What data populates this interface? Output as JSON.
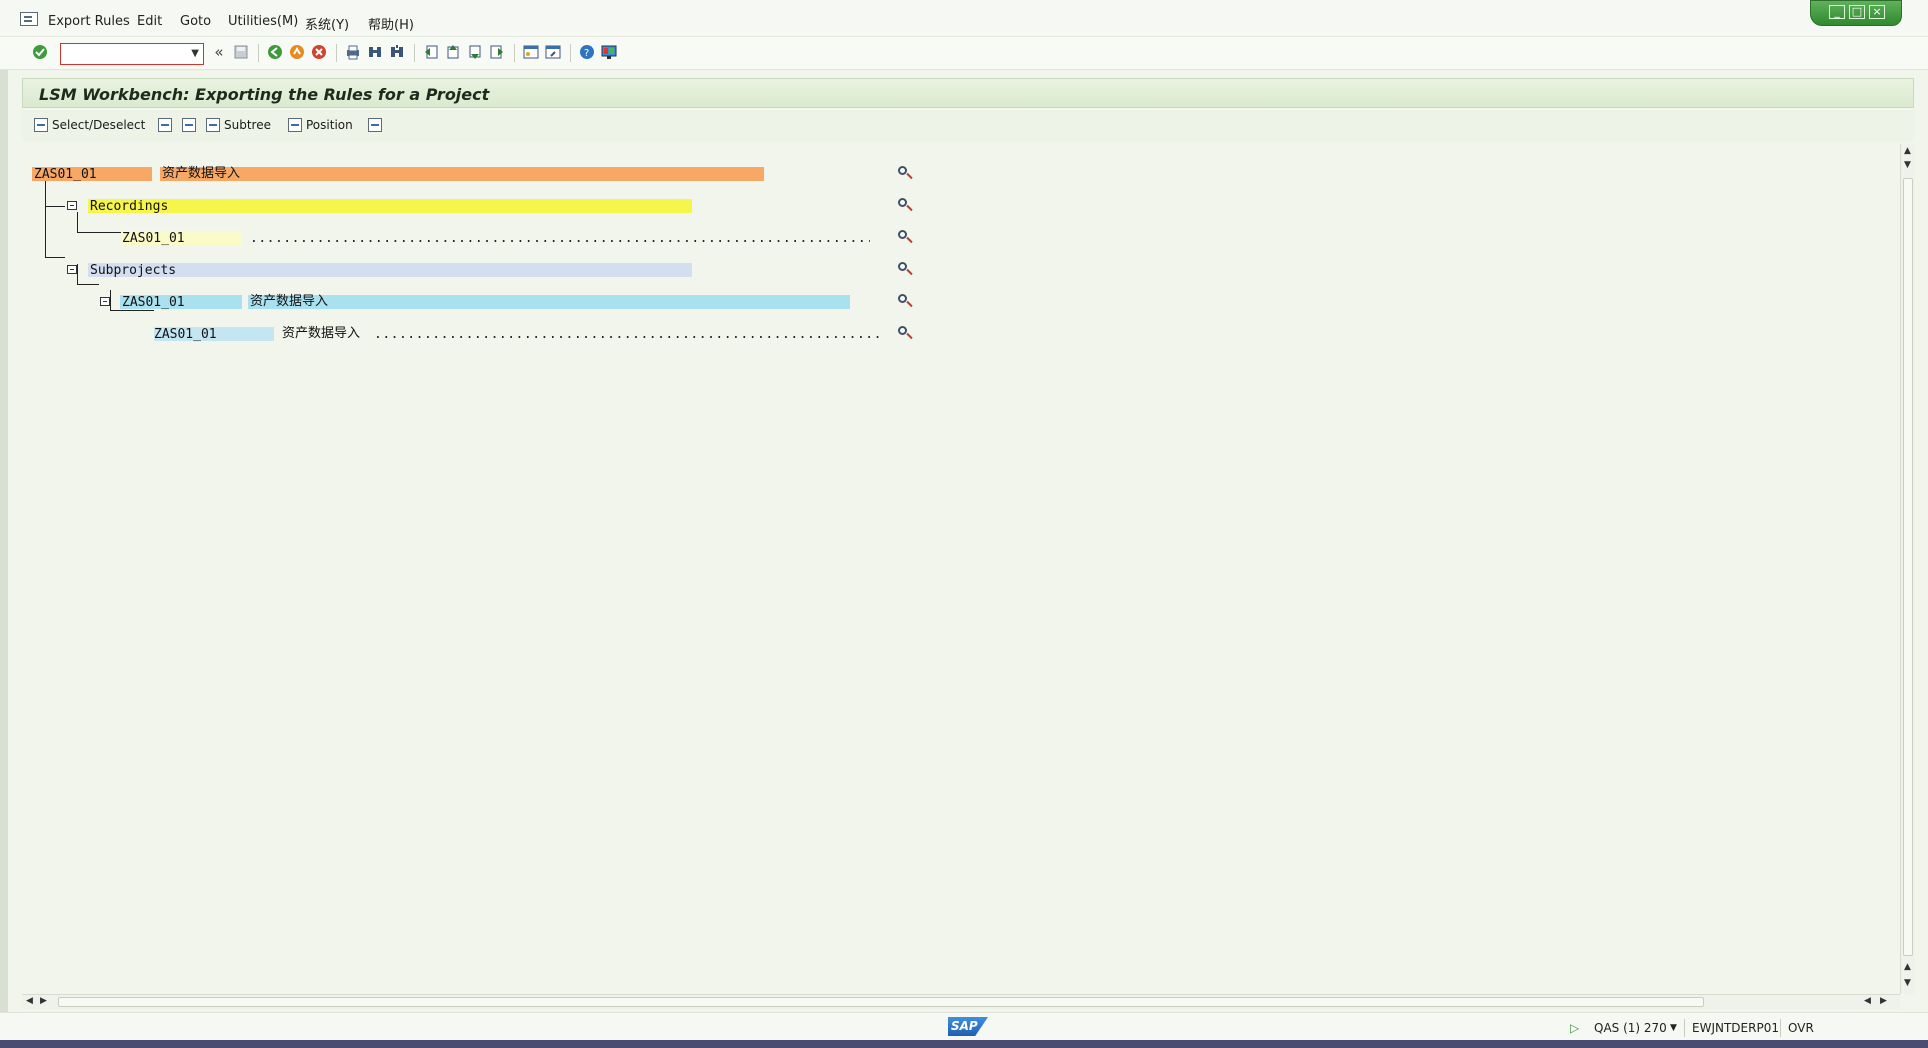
{
  "menu": {
    "items": [
      {
        "label": "Export Rules"
      },
      {
        "label": "Edit"
      },
      {
        "label": "Goto"
      },
      {
        "label": "Utilities(M)"
      },
      {
        "label": "系统(Y)"
      },
      {
        "label": "帮助(H)"
      }
    ]
  },
  "toolbar": {
    "command_field_value": ""
  },
  "title": "LSM Workbench: Exporting the Rules for a Project",
  "app_toolbar": {
    "select_deselect": "Select/Deselect",
    "subtree": "Subtree",
    "position": "Position"
  },
  "tree": {
    "root": {
      "code": "ZAS01_01",
      "desc": "资产数据导入",
      "color": "#f7a865"
    },
    "recordings": {
      "label": "Recordings",
      "color": "#f6f54a"
    },
    "recording_child": {
      "code": "ZAS01_01",
      "color": "#fbfbc8"
    },
    "subprojects": {
      "label": "Subprojects",
      "color": "#d3def0"
    },
    "subproject": {
      "code": "ZAS01_01",
      "desc": "资产数据导入",
      "color": "#a9e1f0"
    },
    "subproject_child": {
      "code": "ZAS01_01",
      "desc": "资产数据导入",
      "color": "#c3e6f2"
    }
  },
  "status": {
    "system": "QAS (1) 270",
    "server": "EWJNTDERP01",
    "mode": "OVR",
    "logo": "SAP"
  },
  "colors": {
    "background": "#f1f5ec",
    "title_bar": "#dbe9cf",
    "window_controls": "#3a9a3a"
  }
}
